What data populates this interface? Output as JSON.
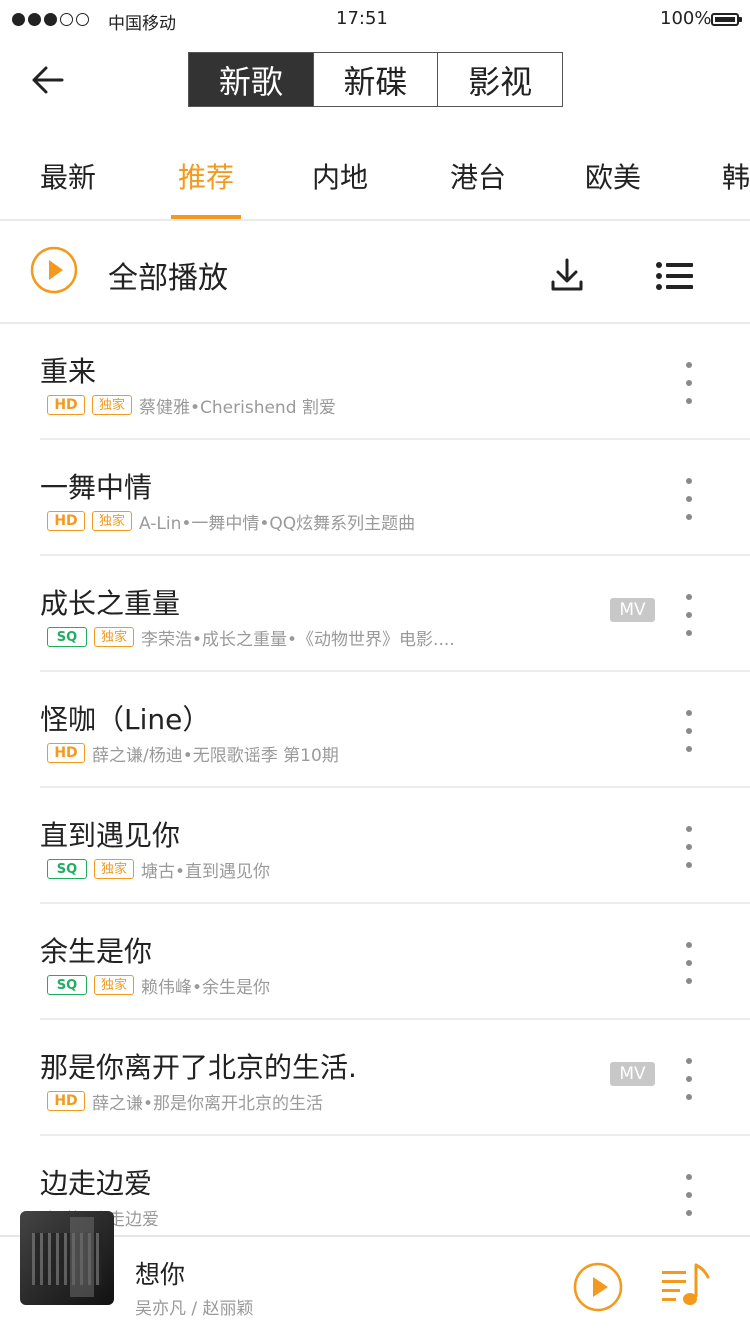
{
  "status": {
    "carrier": "中国移动",
    "time": "17:51",
    "battery": "100%",
    "signal_level": 3,
    "signal_max": 5
  },
  "header": {
    "segments": [
      {
        "label": "新歌",
        "active": true
      },
      {
        "label": "新碟",
        "active": false
      },
      {
        "label": "影视",
        "active": false
      }
    ]
  },
  "categories": {
    "items": [
      "最新",
      "推荐",
      "内地",
      "港台",
      "欧美",
      "韩"
    ],
    "active": "推荐"
  },
  "playall": {
    "label": "全部播放"
  },
  "songs": [
    {
      "title": "重来",
      "badges": [
        "HD",
        "独家"
      ],
      "subtitle": "蔡健雅•Cherishend 割爱",
      "mv": false
    },
    {
      "title": "一舞中情",
      "badges": [
        "HD",
        "独家"
      ],
      "subtitle": "A-Lin•一舞中情•QQ炫舞系列主题曲",
      "mv": false
    },
    {
      "title": "成长之重量",
      "badges": [
        "SQ",
        "独家"
      ],
      "subtitle": "李荣浩•成长之重量•《动物世界》电影....",
      "mv": true
    },
    {
      "title": "怪咖（Line）",
      "badges": [
        "HD"
      ],
      "subtitle": "薛之谦/杨迪•无限歌谣季 第10期",
      "mv": false
    },
    {
      "title": "直到遇见你",
      "badges": [
        "SQ",
        "独家"
      ],
      "subtitle": "塘古•直到遇见你",
      "mv": false
    },
    {
      "title": "余生是你",
      "badges": [
        "SQ",
        "独家"
      ],
      "subtitle": "赖伟峰•余生是你",
      "mv": false
    },
    {
      "title": "那是你离开了北京的生活.",
      "badges": [
        "HD"
      ],
      "subtitle": "薛之谦•那是你离开北京的生活",
      "mv": true
    },
    {
      "title": "边走边爱",
      "badges": [],
      "subtitle": "提莫•边走边爱",
      "mv": false
    }
  ],
  "mv_label": "MV",
  "now_playing": {
    "title": "想你",
    "artist": "吴亦凡 / 赵丽颖"
  },
  "colors": {
    "accent": "#f39a1e",
    "sq_green": "#1fae62",
    "text_secondary": "#9a9a9a"
  },
  "icons": [
    "back-arrow-icon",
    "play-circle-icon",
    "download-icon",
    "list-icon",
    "more-vertical-icon",
    "music-queue-icon"
  ]
}
